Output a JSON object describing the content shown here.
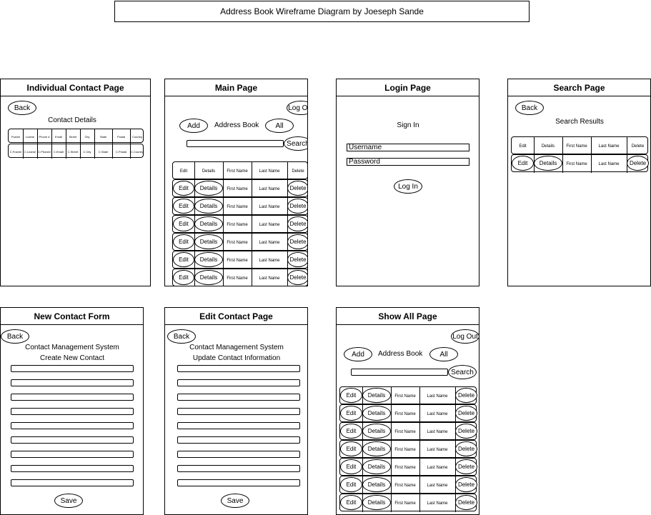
{
  "diagram_title": "Address Book Wireframe Diagram by Joeseph Sande",
  "panels": {
    "individual": {
      "title": "Individual Contact Page",
      "back": "Back",
      "subtitle": "Contact Details",
      "headers": [
        "Fname",
        "Lname",
        "Phone #",
        "Email",
        "Street",
        "City",
        "State",
        "Postal",
        "Country"
      ],
      "values": [
        "C.Fname",
        "C.Lname",
        "C.Phone#",
        "C.Email",
        "C.Street",
        "C.City",
        "C.State",
        "C.Postal",
        "C.Country"
      ]
    },
    "main": {
      "title": "Main Page",
      "logout": "Log Out",
      "add": "Add",
      "heading": "Address Book",
      "all": "All",
      "search": "Search",
      "table_header": [
        "Edit",
        "Details",
        "First Name",
        "Last Name",
        "Delete"
      ],
      "row": {
        "edit": "Edit",
        "details": "Details",
        "first": "First Name",
        "last": "Last Name",
        "delete": "Delete"
      }
    },
    "login": {
      "title": "Login Page",
      "sign_in": "Sign In",
      "username": "Username",
      "password": "Password",
      "login": "Log In"
    },
    "search": {
      "title": "Search Page",
      "back": "Back",
      "subtitle": "Search Results",
      "table_header": [
        "Edit",
        "Details",
        "First Name",
        "Last Name",
        "Delete"
      ],
      "row": {
        "edit": "Edit",
        "details": "Details",
        "first": "First Name",
        "last": "Last Name",
        "delete": "Delete"
      }
    },
    "new_contact": {
      "title": "New Contact Form",
      "back": "Back",
      "line1": "Contact Management System",
      "line2": "Create New Contact",
      "save": "Save"
    },
    "edit_contact": {
      "title": "Edit Contact Page",
      "back": "Back",
      "line1": "Contact Management System",
      "line2": "Update Contact Information",
      "save": "Save"
    },
    "show_all": {
      "title": "Show All Page",
      "logout": "Log Out",
      "add": "Add",
      "heading": "Address Book",
      "all": "All",
      "search": "Search",
      "row": {
        "edit": "Edit",
        "details": "Details",
        "first": "First Name",
        "last": "Last Name",
        "delete": "Delete"
      }
    }
  }
}
